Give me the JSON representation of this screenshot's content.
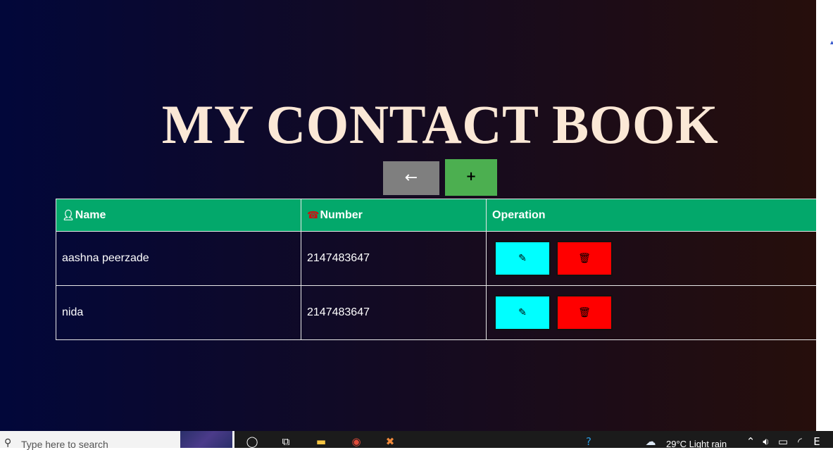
{
  "page": {
    "title": "MY CONTACT BOOK",
    "back_button": "←",
    "add_button": "+"
  },
  "table": {
    "headers": {
      "name": "Name",
      "number": "Number",
      "operation": "Operation"
    },
    "header_icons": {
      "name": "user-icon",
      "number": "phone-icon"
    },
    "rows": [
      {
        "name": "aashna peerzade",
        "number": "2147483647"
      },
      {
        "name": "nida",
        "number": "2147483647"
      }
    ]
  },
  "colors": {
    "header_bg": "#03a86b",
    "edit_button": "#00ffff",
    "delete_button": "#ff0000",
    "back_button": "#7f7f7f",
    "add_button": "#4caf50",
    "title": "#fbe8d6"
  },
  "taskbar": {
    "search_placeholder": "Type here to search",
    "weather": "29°C  Light rain"
  }
}
